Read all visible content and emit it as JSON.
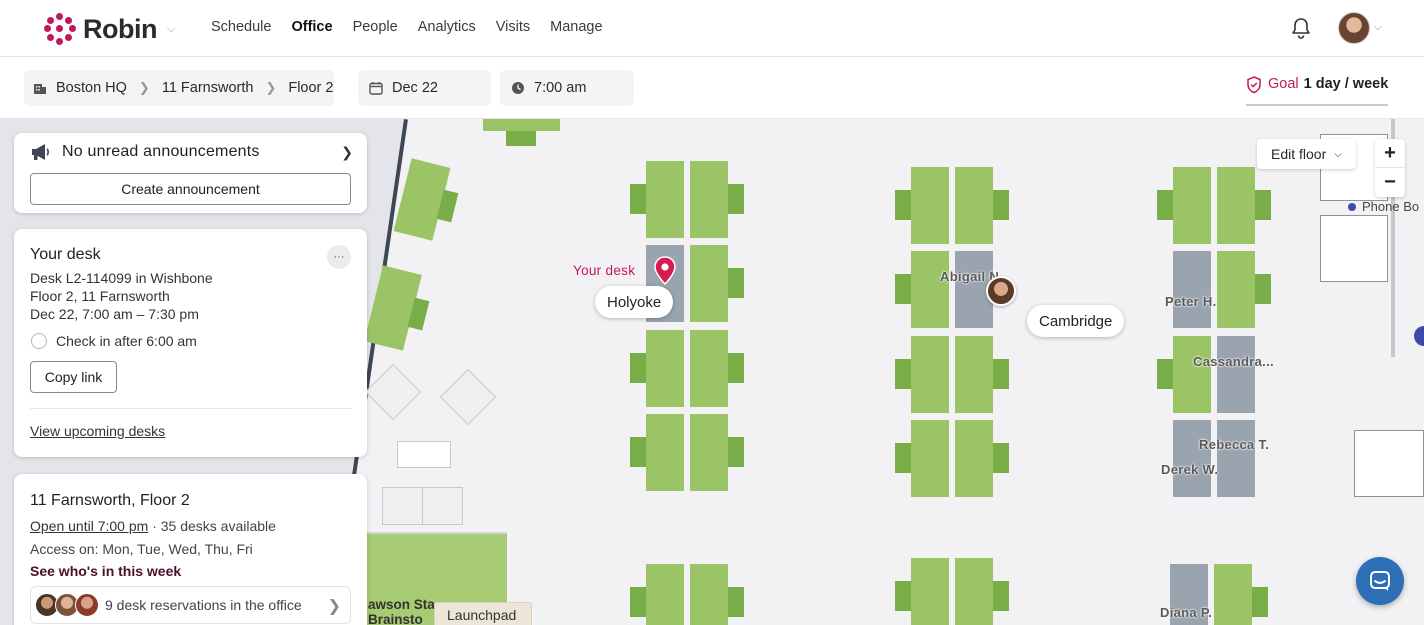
{
  "app": {
    "name": "Robin"
  },
  "nav": {
    "items": [
      "Schedule",
      "Office",
      "People",
      "Analytics",
      "Visits",
      "Manage"
    ],
    "active": "Office"
  },
  "breadcrumb": {
    "building": "Boston HQ",
    "location": "11 Farnsworth",
    "floor": "Floor 2"
  },
  "date": "Dec 22",
  "time": "7:00 am",
  "goal": {
    "label": "Goal",
    "value": "1 day / week"
  },
  "announcements": {
    "title": "No unread announcements",
    "create_label": "Create announcement"
  },
  "your_desk": {
    "title": "Your desk",
    "more_label": "···",
    "desk_line": "Desk L2-114099 in Wishbone",
    "location_line": "Floor 2, 11 Farnsworth",
    "time_line": "Dec 22, 7:00 am – 7:30 pm",
    "checkin_label": "Check in after 6:00 am",
    "copy_link_label": "Copy link",
    "upcoming_label": "View upcoming desks"
  },
  "office": {
    "title": "11 Farnsworth, Floor 2",
    "open_label": "Open until 7:00 pm",
    "desks_available": "35 desks available",
    "access": "Access on: Mon, Tue, Wed, Thu, Fri",
    "see_who": "See who's in this week",
    "reservations": "9 desk reservations in the office"
  },
  "map": {
    "your_desk_tag": "Your desk",
    "rooms": [
      "Holyoke",
      "Cambridge"
    ],
    "people": [
      "Abigail N.",
      "Peter H.",
      "Cassandra...",
      "Rebecca T.",
      "Derek W.",
      "Diana P."
    ],
    "edit_floor_label": "Edit floor",
    "zoom_in": "+",
    "zoom_out": "−",
    "phone_booth": "Phone Bo",
    "launchpad": "Launchpad",
    "lawson_line1": "awson Sta",
    "lawson_line2": "Brainsto"
  },
  "colors": {
    "accent": "#c2185b",
    "desk_available": "#9bc466",
    "desk_booked": "#9aa4af",
    "chair": "#79ad47",
    "chat": "#2d6fb7"
  },
  "icons": [
    "robin-logo-icon",
    "chevron-down-icon",
    "bell-icon",
    "building-icon",
    "calendar-icon",
    "clock-icon",
    "shield-icon",
    "megaphone-icon",
    "chevron-right-icon",
    "map-pin-icon",
    "chat-icon"
  ]
}
